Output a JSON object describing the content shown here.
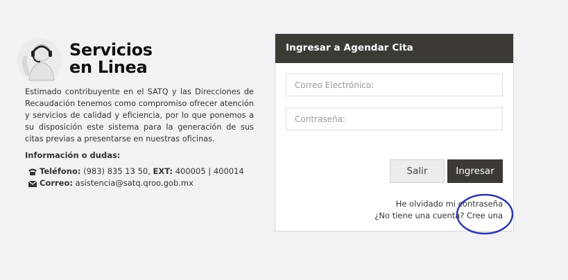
{
  "brand": {
    "title_line1": "Servicios",
    "title_line2": "en Linea"
  },
  "description": "Estimado contribuyente en el SATQ y las Direcciones de Recaudación tenemos como compromiso ofrecer atención y servicios de calidad y eficiencia, por lo que ponemos a su disposición este sistema para la generación de sus citas previas a presentarse en nuestras oficinas.",
  "contact": {
    "heading": "Información o dudas:",
    "phone_label": "Teléfono:",
    "phone_value": "(983) 835 13 50,",
    "ext_label": "EXT:",
    "ext_value": "400005 | 400014",
    "email_label": "Correo:",
    "email_value": "asistencia@satq.qroo.gob.mx",
    "phone_icon": "phone-icon",
    "email_icon": "envelope-icon"
  },
  "login": {
    "header": "Ingresar a Agendar Cita",
    "email_placeholder": "Correo Electrónico:",
    "email_value": "",
    "password_placeholder": "Contraseña:",
    "password_value": "",
    "cancel_label": "Salir",
    "submit_label": "Ingresar",
    "forgot_link": "He olvidado mi contraseña",
    "signup_link": "¿No tiene una cuenta? Cree una"
  },
  "colors": {
    "background": "#f2f1f4",
    "header": "#3d3935",
    "annotation_circle": "#2b35a8"
  }
}
